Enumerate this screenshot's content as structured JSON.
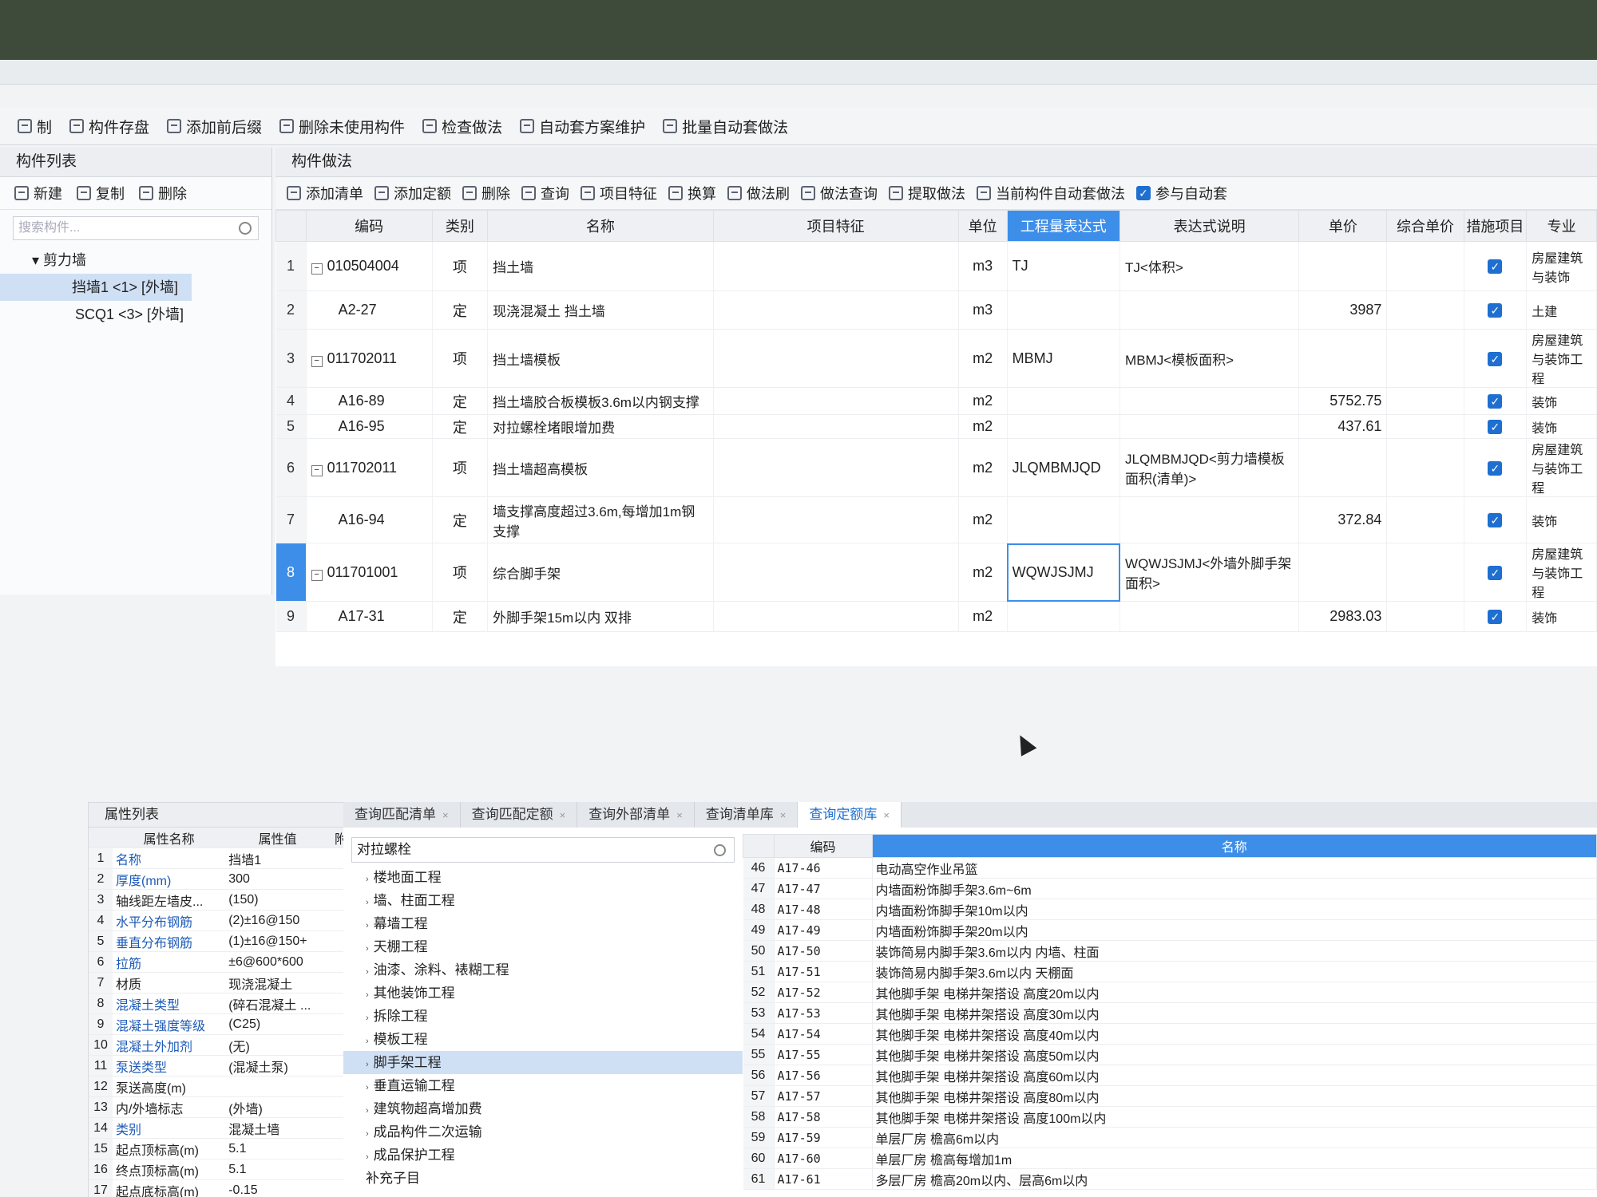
{
  "toolbar": {
    "items": [
      "制",
      "构件存盘",
      "添加前后缀",
      "删除未使用构件",
      "检查做法",
      "自动套方案维护",
      "批量自动套做法"
    ]
  },
  "left_panel": {
    "title": "构件列表",
    "tools": [
      "新建",
      "复制",
      "删除"
    ],
    "search_placeholder": "搜索构件...",
    "tree_root": "剪力墙",
    "tree_items": [
      "挡墙1 <1> [外墙]",
      "SCQ1 <3> [外墙]"
    ]
  },
  "right_panel": {
    "title": "构件做法",
    "tools": [
      "添加清单",
      "添加定额",
      "删除",
      "查询",
      "项目特征",
      "换算",
      "做法刷",
      "做法查询",
      "提取做法",
      "当前构件自动套做法",
      "参与自动套"
    ],
    "columns": [
      "编码",
      "类别",
      "名称",
      "项目特征",
      "单位",
      "工程量表达式",
      "表达式说明",
      "单价",
      "综合单价",
      "措施项目",
      "专业"
    ],
    "rows": [
      {
        "n": "1",
        "code": "010504004",
        "type": "项",
        "name": "挡土墙",
        "unit": "m3",
        "expr": "TJ",
        "desc": "TJ<体积>",
        "price": "",
        "measure": true,
        "spec": "房屋建筑与装饰"
      },
      {
        "n": "2",
        "code": "A2-27",
        "type": "定",
        "name": "现浇混凝土 挡土墙",
        "unit": "m3",
        "expr": "",
        "desc": "",
        "price": "3987",
        "measure": true,
        "spec": "土建"
      },
      {
        "n": "3",
        "code": "011702011",
        "type": "项",
        "name": "挡土墙模板",
        "unit": "m2",
        "expr": "MBMJ",
        "desc": "MBMJ<模板面积>",
        "price": "",
        "measure": true,
        "spec": "房屋建筑与装饰工程"
      },
      {
        "n": "4",
        "code": "A16-89",
        "type": "定",
        "name": "挡土墙胶合板模板3.6m以内钢支撑",
        "unit": "m2",
        "expr": "",
        "desc": "",
        "price": "5752.75",
        "measure": true,
        "spec": "装饰"
      },
      {
        "n": "5",
        "code": "A16-95",
        "type": "定",
        "name": "对拉螺栓堵眼增加费",
        "unit": "m2",
        "expr": "",
        "desc": "",
        "price": "437.61",
        "measure": true,
        "spec": "装饰"
      },
      {
        "n": "6",
        "code": "011702011",
        "type": "项",
        "name": "挡土墙超高模板",
        "unit": "m2",
        "expr": "JLQMBMJQD",
        "desc": "JLQMBMJQD<剪力墙模板面积(清单)>",
        "price": "",
        "measure": true,
        "spec": "房屋建筑与装饰工程"
      },
      {
        "n": "7",
        "code": "A16-94",
        "type": "定",
        "name": "墙支撑高度超过3.6m,每增加1m钢支撑",
        "unit": "m2",
        "expr": "",
        "desc": "",
        "price": "372.84",
        "measure": true,
        "spec": "装饰"
      },
      {
        "n": "8",
        "code": "011701001",
        "type": "项",
        "name": "综合脚手架",
        "unit": "m2",
        "expr": "WQWJSJMJ",
        "desc": "WQWJSJMJ<外墙外脚手架面积>",
        "price": "",
        "measure": true,
        "spec": "房屋建筑与装饰工程"
      },
      {
        "n": "9",
        "code": "A17-31",
        "type": "定",
        "name": "外脚手架15m以内 双排",
        "unit": "m2",
        "expr": "",
        "desc": "",
        "price": "2983.03",
        "measure": true,
        "spec": "装饰"
      }
    ]
  },
  "props": {
    "title": "属性列表",
    "columns": [
      "属性名称",
      "属性值",
      "附"
    ],
    "rows": [
      {
        "n": "1",
        "name": "名称",
        "value": "挡墙1"
      },
      {
        "n": "2",
        "name": "厚度(mm)",
        "value": "300"
      },
      {
        "n": "3",
        "name": "轴线距左墙皮...",
        "value": "(150)"
      },
      {
        "n": "4",
        "name": "水平分布钢筋",
        "value": "(2)±16@150"
      },
      {
        "n": "5",
        "name": "垂直分布钢筋",
        "value": "(1)±16@150+"
      },
      {
        "n": "6",
        "name": "拉筋",
        "value": "±6@600*600"
      },
      {
        "n": "7",
        "name": "材质",
        "value": "现浇混凝土"
      },
      {
        "n": "8",
        "name": "混凝土类型",
        "value": "(碎石混凝土 ..."
      },
      {
        "n": "9",
        "name": "混凝土强度等级",
        "value": "(C25)"
      },
      {
        "n": "10",
        "name": "混凝土外加剂",
        "value": "(无)"
      },
      {
        "n": "11",
        "name": "泵送类型",
        "value": "(混凝土泵)"
      },
      {
        "n": "12",
        "name": "泵送高度(m)",
        "value": ""
      },
      {
        "n": "13",
        "name": "内/外墙标志",
        "value": "(外墙)"
      },
      {
        "n": "14",
        "name": "类别",
        "value": "混凝土墙"
      },
      {
        "n": "15",
        "name": "起点顶标高(m)",
        "value": "5.1"
      },
      {
        "n": "16",
        "name": "终点顶标高(m)",
        "value": "5.1"
      },
      {
        "n": "17",
        "name": "起点底标高(m)",
        "value": "-0.15"
      }
    ]
  },
  "query": {
    "tabs": [
      "查询匹配清单",
      "查询匹配定额",
      "查询外部清单",
      "查询清单库",
      "查询定额库"
    ],
    "search_value": "对拉螺栓",
    "tree": [
      "楼地面工程",
      "墙、柱面工程",
      "幕墙工程",
      "天棚工程",
      "油漆、涂料、裱糊工程",
      "其他装饰工程",
      "拆除工程",
      "模板工程",
      "脚手架工程",
      "垂直运输工程",
      "建筑物超高增加费",
      "成品构件二次运输",
      "成品保护工程",
      "补充子目"
    ],
    "columns": [
      "编码",
      "名称"
    ],
    "rows": [
      {
        "n": "46",
        "code": "A17-46",
        "name": "电动高空作业吊篮"
      },
      {
        "n": "47",
        "code": "A17-47",
        "name": "内墙面粉饰脚手架3.6m~6m"
      },
      {
        "n": "48",
        "code": "A17-48",
        "name": "内墙面粉饰脚手架10m以内"
      },
      {
        "n": "49",
        "code": "A17-49",
        "name": "内墙面粉饰脚手架20m以内"
      },
      {
        "n": "50",
        "code": "A17-50",
        "name": "装饰简易内脚手架3.6m以内 内墙、柱面"
      },
      {
        "n": "51",
        "code": "A17-51",
        "name": "装饰简易内脚手架3.6m以内 天棚面"
      },
      {
        "n": "52",
        "code": "A17-52",
        "name": "其他脚手架 电梯井架搭设 高度20m以内"
      },
      {
        "n": "53",
        "code": "A17-53",
        "name": "其他脚手架 电梯井架搭设 高度30m以内"
      },
      {
        "n": "54",
        "code": "A17-54",
        "name": "其他脚手架 电梯井架搭设 高度40m以内"
      },
      {
        "n": "55",
        "code": "A17-55",
        "name": "其他脚手架 电梯井架搭设 高度50m以内"
      },
      {
        "n": "56",
        "code": "A17-56",
        "name": "其他脚手架 电梯井架搭设 高度60m以内"
      },
      {
        "n": "57",
        "code": "A17-57",
        "name": "其他脚手架 电梯井架搭设 高度80m以内"
      },
      {
        "n": "58",
        "code": "A17-58",
        "name": "其他脚手架 电梯井架搭设 高度100m以内"
      },
      {
        "n": "59",
        "code": "A17-59",
        "name": "单层厂房 檐高6m以内"
      },
      {
        "n": "60",
        "code": "A17-60",
        "name": "单层厂房 檐高每增加1m"
      },
      {
        "n": "61",
        "code": "A17-61",
        "name": "多层厂房 檐高20m以内、层高6m以内"
      }
    ]
  }
}
